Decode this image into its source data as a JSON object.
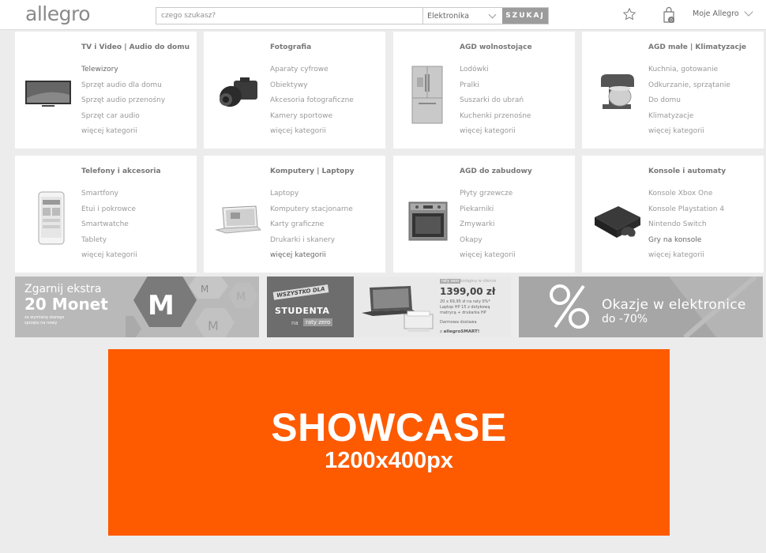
{
  "header": {
    "logo": "allegro",
    "search_placeholder": "czego szukasz?",
    "search_category": "Elektronika",
    "search_button": "SZUKAJ",
    "user_menu": "Moje Allegro"
  },
  "categories": [
    {
      "title": "TV i Video | Audio do domu",
      "items": [
        "Telewizory",
        "Sprzęt audio dla domu",
        "Sprzęt audio przenośny",
        "Sprzęt car audio",
        "więcej kategorii"
      ],
      "icon": "tv-icon"
    },
    {
      "title": "Fotografia",
      "items": [
        "Aparaty cyfrowe",
        "Obiektywy",
        "Akcesoria fotograficzne",
        "Kamery sportowe",
        "więcej kategorii"
      ],
      "icon": "camera-icon"
    },
    {
      "title": "AGD wolnostojące",
      "items": [
        "Lodówki",
        "Pralki",
        "Suszarki do ubrań",
        "Kuchenki przenośne",
        "więcej kategorii"
      ],
      "icon": "fridge-icon"
    },
    {
      "title": "AGD małe | Klimatyzacje",
      "items": [
        "Kuchnia, gotowanie",
        "Odkurzanie, sprzątanie",
        "Do domu",
        "Klimatyzacje",
        "więcej kategorii"
      ],
      "icon": "mixer-icon"
    },
    {
      "title": "Telefony i akcesoria",
      "items": [
        "Smartfony",
        "Etui i pokrowce",
        "Smartwatche",
        "Tablety",
        "więcej kategorii"
      ],
      "icon": "phone-icon"
    },
    {
      "title": "Komputery | Laptopy",
      "items": [
        "Laptopy",
        "Komputery stacjonarne",
        "Karty graficzne",
        "Drukarki i skanery",
        "więcej kategorii"
      ],
      "icon": "laptop-icon"
    },
    {
      "title": "AGD do zabudowy",
      "items": [
        "Płyty grzewcze",
        "Piekarniki",
        "Zmywarki",
        "Okapy",
        "więcej kategorii"
      ],
      "icon": "oven-icon"
    },
    {
      "title": "Konsole i automaty",
      "items": [
        "Konsole Xbox One",
        "Konsole Playstation 4",
        "Nintendo Switch",
        "Gry na konsole",
        "więcej kategorii"
      ],
      "icon": "console-icon"
    }
  ],
  "banners": {
    "coins": {
      "line1": "Zgarnij ekstra",
      "line2": "20 Monet",
      "small": "za wymianę starego sprzętu na nowy"
    },
    "student": {
      "tag": "WSZYSTKO DLA",
      "headline": "STUDENTA",
      "na": "na",
      "raty": "raty zero",
      "badge": "raty zero",
      "badge_note": "dostępny w ofercie",
      "price": "1399,00 zł",
      "line1": "20 x 69,95 zł na raty 0%*",
      "line2": "Laptop HP 15 z dotykową",
      "line3": "matrycą + drukarka HP",
      "line4": "Darmowa dostawa",
      "smart_prefix": "z",
      "smart_brand": "allegroSMART!"
    },
    "deals": {
      "line1": "Okazje w elektronice",
      "line2": "do -70%"
    }
  },
  "showcase": {
    "title": "SHOWCASE",
    "size": "1200x400px"
  }
}
